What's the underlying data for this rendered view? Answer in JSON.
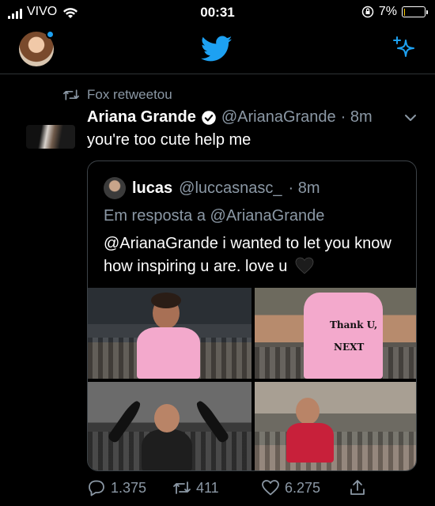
{
  "status_bar": {
    "carrier": "VIVO",
    "time": "00:31",
    "battery_percent": "7%",
    "battery_level": 0.07
  },
  "header": {
    "logo": "twitter-bird-icon",
    "sparkle": "sparkle-icon"
  },
  "tweet": {
    "retweeted_by": "Fox retweetou",
    "author_name": "Ariana Grande",
    "author_handle": "@ArianaGrande",
    "time": "· 8m",
    "text": "you're too cute help me",
    "quoted": {
      "author_name": "lucas",
      "author_handle": "@luccasnasc_",
      "time": "· 8m",
      "reply_to_prefix": "Em resposta a",
      "reply_to_handle": "@ArianaGrande",
      "text": "@ArianaGrande i wanted to let you know how inspiring u are. love u",
      "photos": [
        "photo-1",
        "photo-2",
        "photo-3",
        "photo-4"
      ]
    },
    "actions": {
      "replies": "1.375",
      "retweets": "411",
      "likes": "6.275"
    }
  },
  "colors": {
    "background": "#000000",
    "twitter_blue": "#1da1f2",
    "secondary_text": "#8b98a5",
    "border": "#3d4348"
  }
}
